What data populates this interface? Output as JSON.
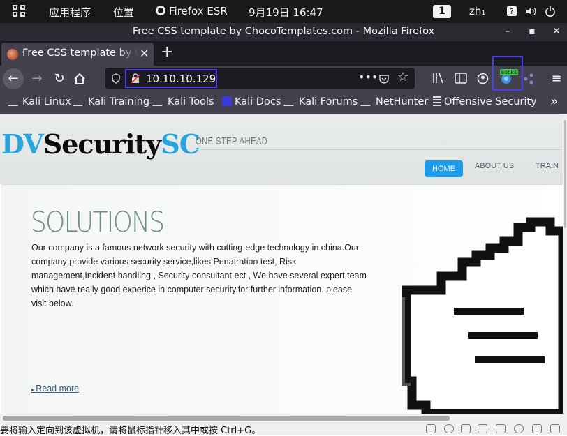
{
  "system_bar": {
    "apps_menu": "应用程序",
    "places_menu": "位置",
    "firefox_label": "Firefox ESR",
    "datetime": "9月19日  16:47",
    "workspace": "1",
    "lang": "zh₁"
  },
  "window": {
    "title": "Free CSS template by ChocoTemplates.com - Mozilla Firefox"
  },
  "tab": {
    "label": "Free CSS template by ChocoTemplates.com"
  },
  "urlbar": {
    "url": "10.10.10.129"
  },
  "extension": {
    "badge": "socks"
  },
  "bookmarks": [
    {
      "label": "Kali Linux"
    },
    {
      "label": "Kali Training"
    },
    {
      "label": "Kali Tools"
    },
    {
      "label": "Kali Docs"
    },
    {
      "label": "Kali Forums"
    },
    {
      "label": "NetHunter"
    },
    {
      "label": "Offensive Security"
    }
  ],
  "site": {
    "logo_dv": "DV",
    "logo_security": "Security",
    "logo_sc": "SC",
    "tagline": "ONE STEP AHEAD",
    "menu": [
      "HOME",
      "ABOUT US",
      "TRAIN"
    ],
    "hero_title": "SOLUTIONS",
    "hero_text": "Our company is a famous network security with cutting-edge technology in china.Our company provide various security service,likes Penatration test, Risk management,Incident handling , Security consultant ect , We have several expert team which have really good experice in computer security.for further information. please visit below.",
    "read_more": "Read more"
  },
  "statusbar": {
    "message": "要将输入定向到该虚拟机，请将鼠标指针移入其中或按 Ctrl+G。"
  },
  "colors": {
    "accent_blue": "#1d9be8",
    "logo_blue": "#2aa4dc",
    "highlight_box": "#4a3cf0"
  }
}
